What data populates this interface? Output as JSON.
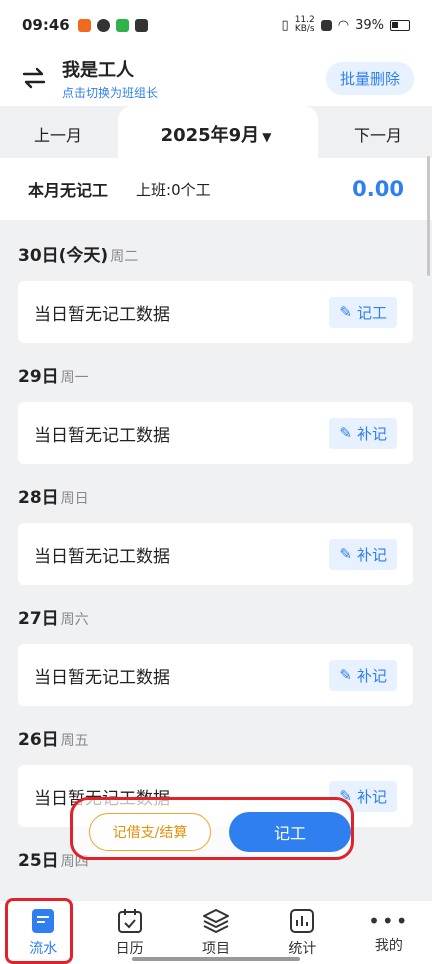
{
  "status": {
    "time": "09:46",
    "speed": "11.2\nKB/s",
    "battery": "39%"
  },
  "header": {
    "title": "我是工人",
    "subtitle": "点击切换为班组长",
    "batch_delete": "批量删除"
  },
  "month_nav": {
    "prev": "上一月",
    "current": "2025年9月",
    "next": "下一月"
  },
  "summary": {
    "no_record": "本月无记工",
    "work": "上班:0个工",
    "amount": "0.00"
  },
  "days": [
    {
      "date": "30日(今天)",
      "weekday": "周二",
      "text": "当日暂无记工数据",
      "action": "记工"
    },
    {
      "date": "29日",
      "weekday": "周一",
      "text": "当日暂无记工数据",
      "action": "补记"
    },
    {
      "date": "28日",
      "weekday": "周日",
      "text": "当日暂无记工数据",
      "action": "补记"
    },
    {
      "date": "27日",
      "weekday": "周六",
      "text": "当日暂无记工数据",
      "action": "补记"
    },
    {
      "date": "26日",
      "weekday": "周五",
      "text": "当日暂无记工数据",
      "action": "补记"
    },
    {
      "date": "25日",
      "weekday": "周四"
    }
  ],
  "actions": {
    "loan": "记借支/结算",
    "record": "记工"
  },
  "bottom_nav": [
    {
      "label": "流水",
      "icon": "list-icon"
    },
    {
      "label": "日历",
      "icon": "calendar-icon"
    },
    {
      "label": "项目",
      "icon": "layers-icon"
    },
    {
      "label": "统计",
      "icon": "chart-icon"
    },
    {
      "label": "我的",
      "icon": "more-icon"
    }
  ],
  "colors": {
    "accent": "#2f7ff0",
    "warning": "#f0a528",
    "highlight": "#e0232a"
  }
}
